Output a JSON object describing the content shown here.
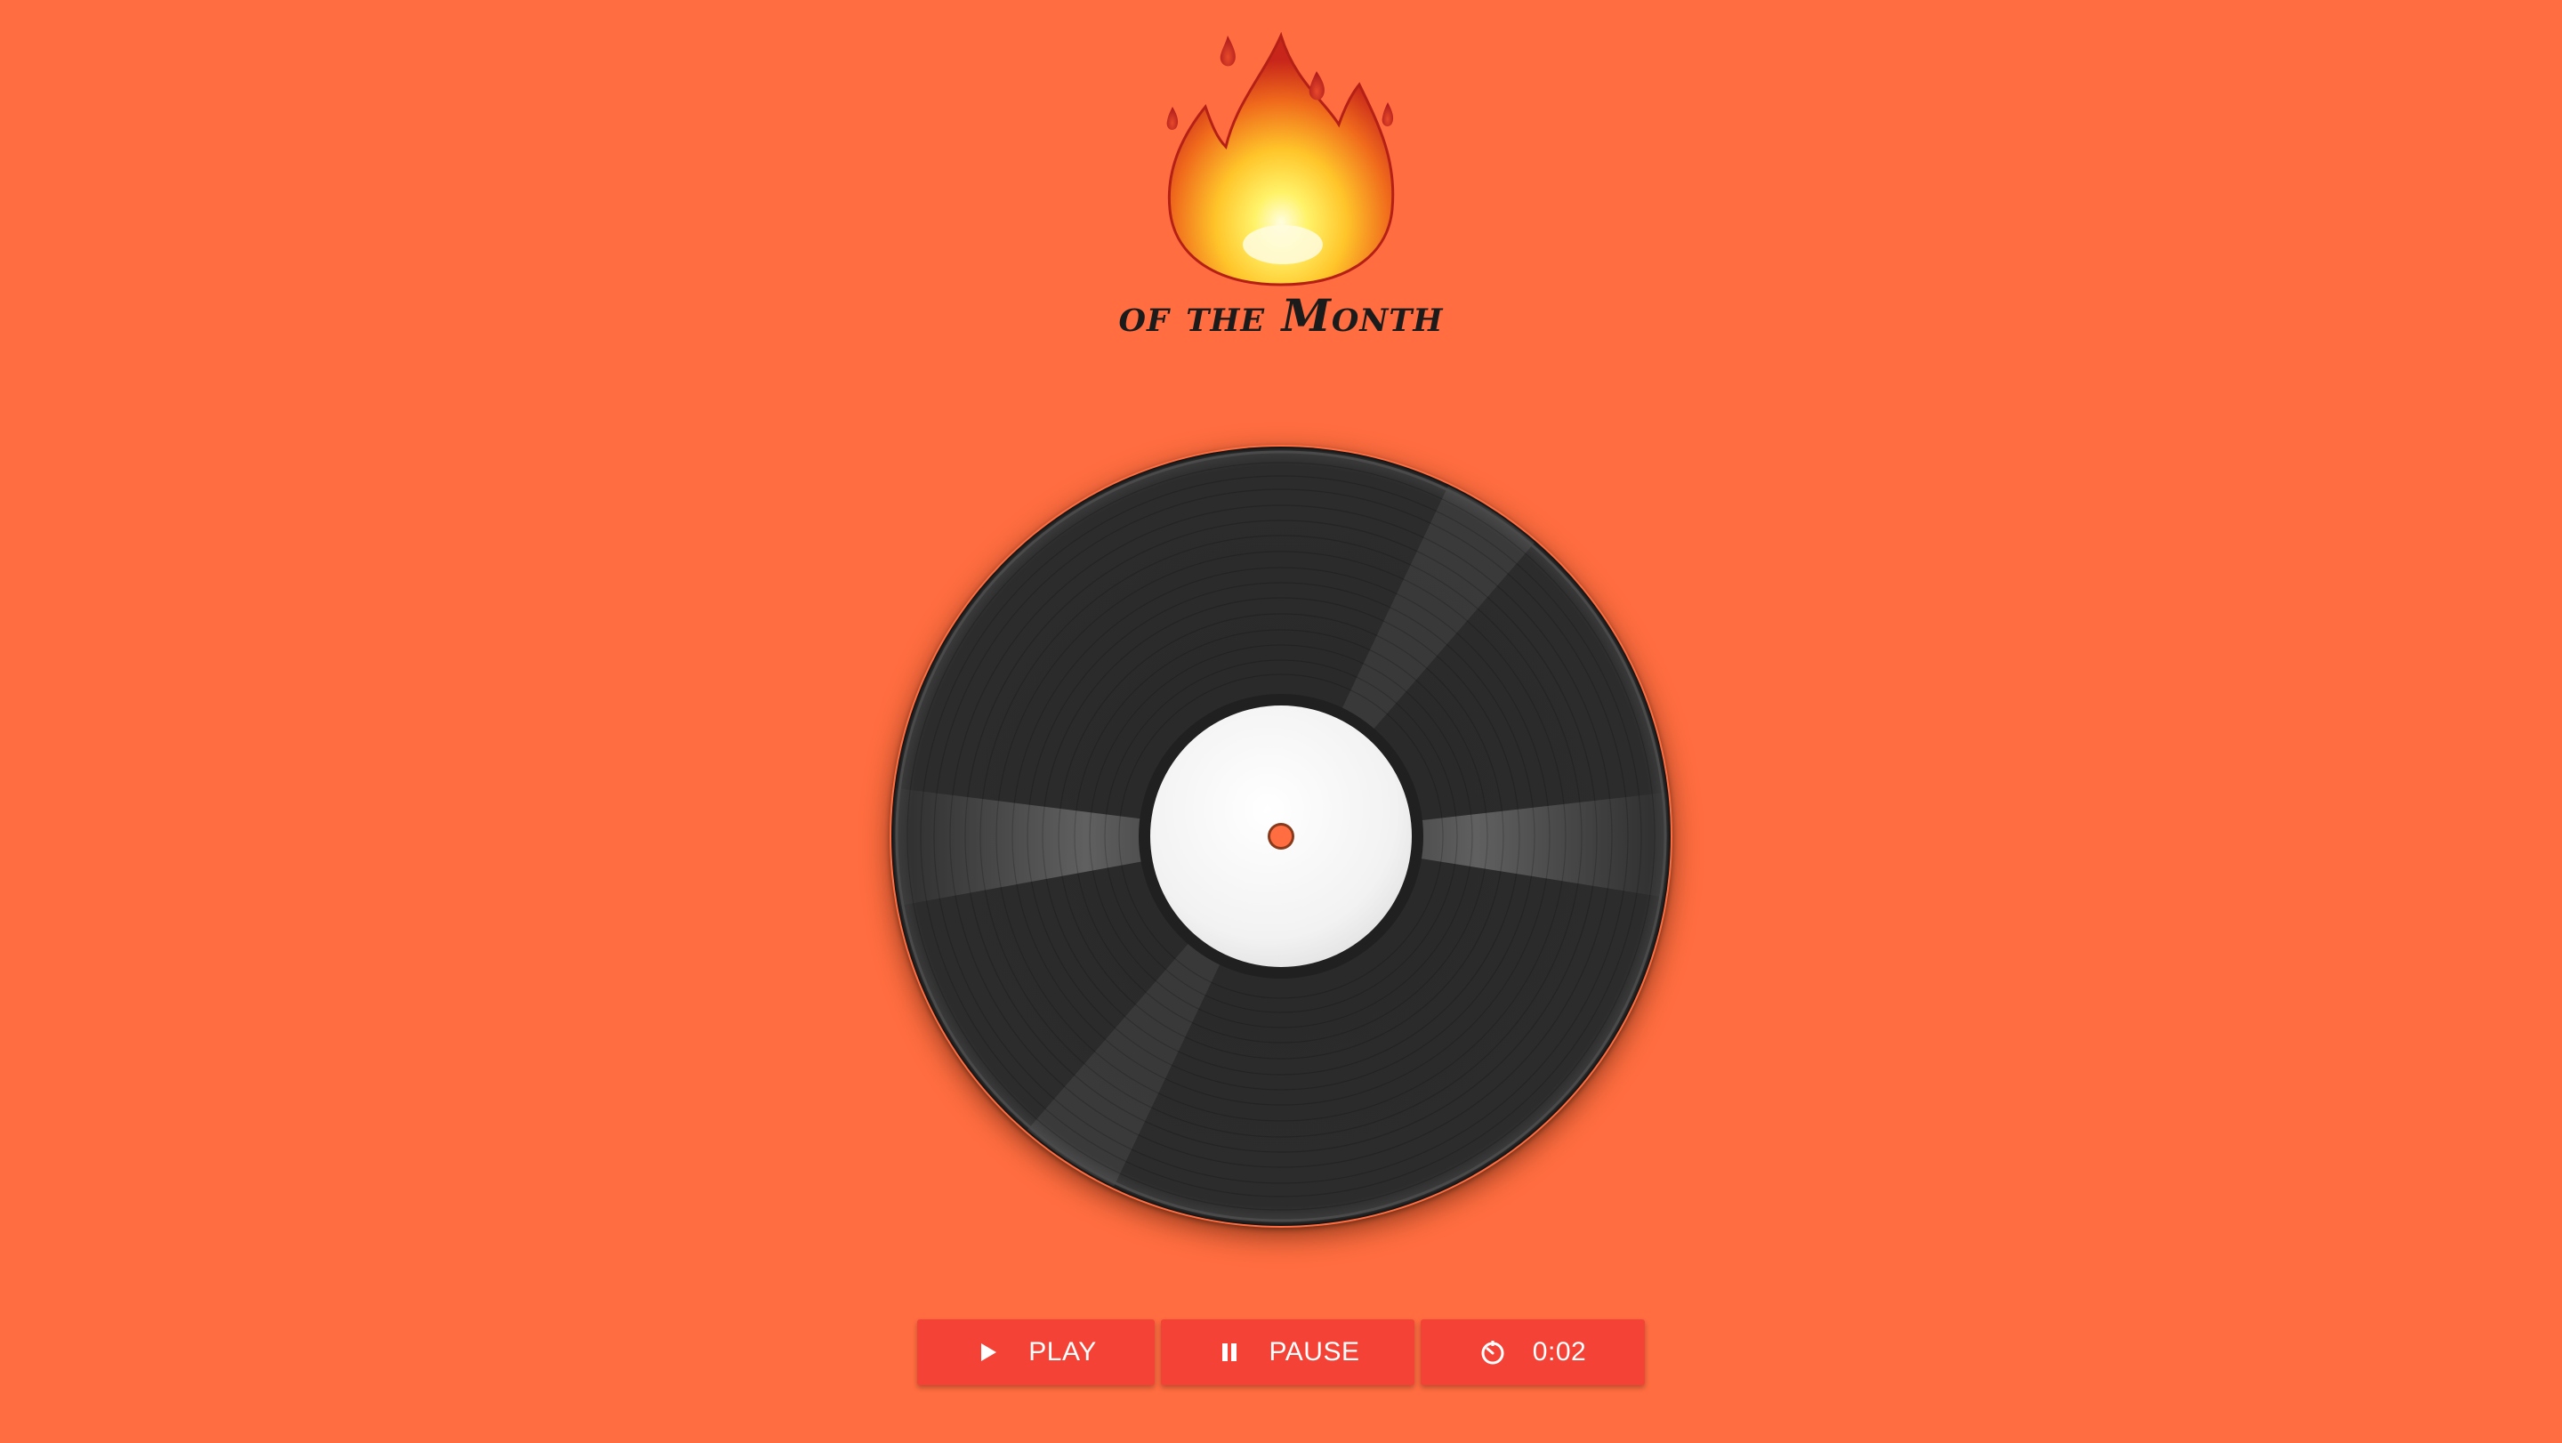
{
  "header": {
    "logo_icon": "fire-icon",
    "subtitle": "of the Month"
  },
  "player": {
    "record_icon": "vinyl-record",
    "play_label": "PLAY",
    "play_icon": "play-icon",
    "pause_label": "PAUSE",
    "pause_icon": "pause-icon",
    "timer_label": "0:02",
    "timer_icon": "timer-icon"
  },
  "colors": {
    "background": "#ff6d40",
    "button": "#f44336",
    "button_text": "#ffffff"
  }
}
